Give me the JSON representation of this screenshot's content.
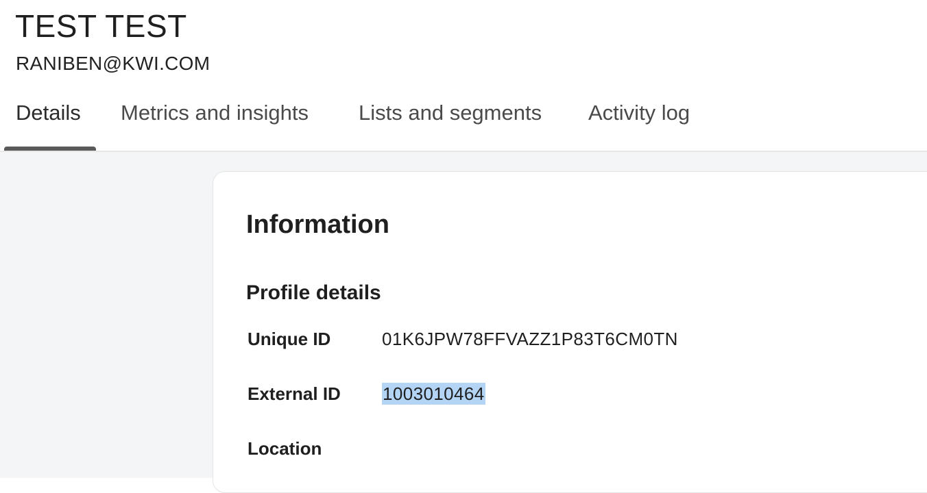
{
  "profile": {
    "name": "TEST TEST",
    "email": "RANIBEN@KWI.COM"
  },
  "tabs": [
    {
      "label": "Details",
      "active": true
    },
    {
      "label": "Metrics and insights",
      "active": false
    },
    {
      "label": "Lists and segments",
      "active": false
    },
    {
      "label": "Activity log",
      "active": false
    }
  ],
  "information": {
    "title": "Information",
    "section_title": "Profile details",
    "fields": [
      {
        "label": "Unique ID",
        "value": "01K6JPW78FFVAZZ1P83T6CM0TN"
      },
      {
        "label": "External ID",
        "value": "1003010464",
        "selected": true
      },
      {
        "label": "Location",
        "value": ""
      }
    ]
  },
  "colors": {
    "selection_highlight": "#b3d4f5",
    "content_background": "#f4f5f6",
    "tab_indicator": "#5a5a5a"
  }
}
